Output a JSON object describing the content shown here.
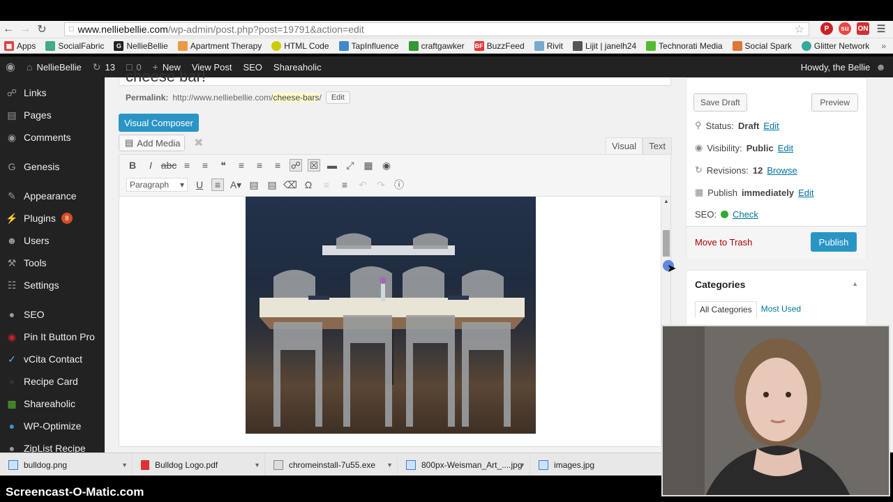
{
  "browser": {
    "url_host": "www.nelliebellie.com",
    "url_path": "/wp-admin/post.php?post=19791&action=edit",
    "bookmarks": [
      "Apps",
      "SocialFabric",
      "NellieBellie",
      "Apartment Therapy",
      "HTML Code",
      "TapInfluence",
      "craftgawker",
      "BuzzFeed",
      "Rivit",
      "Lijit | janelh24",
      "Technorati Media",
      "Social Spark",
      "Glitter Network"
    ]
  },
  "adminbar": {
    "site": "NellieBellie",
    "updates": "13",
    "comments": "0",
    "new": "New",
    "view_post": "View Post",
    "seo": "SEO",
    "shareaholic": "Shareaholic",
    "howdy": "Howdy, the Bellie"
  },
  "sidebar": {
    "items": [
      {
        "label": "Links",
        "icon": "link-icon"
      },
      {
        "label": "Pages",
        "icon": "page-icon"
      },
      {
        "label": "Comments",
        "icon": "comment-icon"
      },
      {
        "label": "Genesis",
        "icon": "genesis-icon"
      },
      {
        "label": "Appearance",
        "icon": "brush-icon"
      },
      {
        "label": "Plugins",
        "icon": "plugin-icon",
        "badge": "8"
      },
      {
        "label": "Users",
        "icon": "users-icon"
      },
      {
        "label": "Tools",
        "icon": "wrench-icon"
      },
      {
        "label": "Settings",
        "icon": "settings-icon"
      },
      {
        "label": "SEO",
        "icon": "seo-icon"
      },
      {
        "label": "Pin It Button Pro",
        "icon": "pinterest-icon"
      },
      {
        "label": "vCita Contact",
        "icon": "vcita-icon"
      },
      {
        "label": "Recipe Card",
        "icon": "recipe-icon"
      },
      {
        "label": "Shareaholic",
        "icon": "shareaholic-icon"
      },
      {
        "label": "WP-Optimize",
        "icon": "optimize-icon"
      },
      {
        "label": "ZipList Recipe",
        "icon": "ziplist-icon"
      }
    ]
  },
  "editor": {
    "title_partial": "cheese bar!",
    "permalink_label": "Permalink:",
    "permalink_base": "http://www.nelliebellie.com/",
    "permalink_slug": "cheese-bars",
    "permalink_tail": "/",
    "edit": "Edit",
    "visual_composer": "Visual Composer",
    "add_media": "Add Media",
    "tab_visual": "Visual",
    "tab_text": "Text",
    "format_select": "Paragraph"
  },
  "publish": {
    "save_draft": "Save Draft",
    "preview": "Preview",
    "status_label": "Status:",
    "status_value": "Draft",
    "visibility_label": "Visibility:",
    "visibility_value": "Public",
    "revisions_label": "Revisions:",
    "revisions_value": "12",
    "browse": "Browse",
    "publish_label": "Publish",
    "publish_value": "immediately",
    "seo_label": "SEO:",
    "seo_check": "Check",
    "edit": "Edit",
    "move_to_trash": "Move to Trash",
    "publish_button": "Publish"
  },
  "categories": {
    "heading": "Categories",
    "tab_all": "All Categories",
    "tab_used": "Most Used"
  },
  "downloads": [
    "bulldog.png",
    "Bulldog Logo.pdf",
    "chromeinstall-7u55.exe",
    "800px-Weisman_Art_....jpg",
    "images.jpg"
  ],
  "watermark": "Screencast-O-Matic.com",
  "colors": {
    "accent": "#2a95c5",
    "admin_bar": "#222222",
    "link": "#0074a2"
  }
}
